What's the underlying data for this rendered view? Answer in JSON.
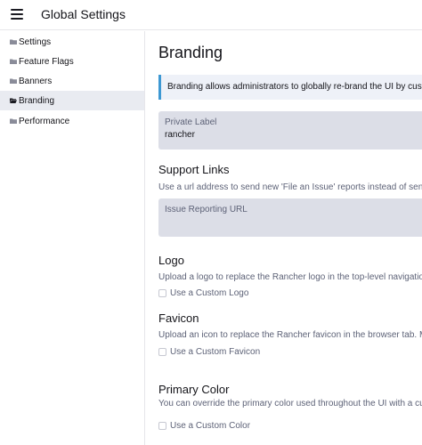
{
  "header": {
    "menu_icon": "hamburger-icon",
    "title": "Global Settings"
  },
  "sidebar": {
    "items": [
      {
        "label": "Settings",
        "icon": "folder-icon",
        "active": false
      },
      {
        "label": "Feature Flags",
        "icon": "folder-icon",
        "active": false
      },
      {
        "label": "Banners",
        "icon": "folder-icon",
        "active": false
      },
      {
        "label": "Branding",
        "icon": "folder-open-icon",
        "active": true
      },
      {
        "label": "Performance",
        "icon": "folder-icon",
        "active": false
      }
    ]
  },
  "main": {
    "title": "Branding",
    "info_banner": "Branding allows administrators to globally re-brand the UI by custo",
    "private_label": {
      "label": "Private Label",
      "value": "rancher"
    },
    "support_links": {
      "title": "Support Links",
      "description": "Use a url address to send new 'File an Issue' reports instead of sendin",
      "issue_url": {
        "label": "Issue Reporting URL",
        "value": ""
      }
    },
    "logo": {
      "title": "Logo",
      "description": "Upload a logo to replace the Rancher logo in the top-level navigation",
      "checkbox_label": "Use a Custom Logo",
      "checked": false
    },
    "favicon": {
      "title": "Favicon",
      "description": "Upload an icon to replace the Rancher favicon in the browser tab. Ma",
      "checkbox_label": "Use a Custom Favicon",
      "checked": false
    },
    "primary_color": {
      "title": "Primary Color",
      "description": "You can override the primary color used throughout the UI with a cus",
      "checkbox_label": "Use a Custom Color",
      "checked": false
    }
  },
  "colors": {
    "accent_border": "#3d98d3",
    "active_nav_bg": "#e9ebf1",
    "field_bg": "#dcdee7"
  }
}
